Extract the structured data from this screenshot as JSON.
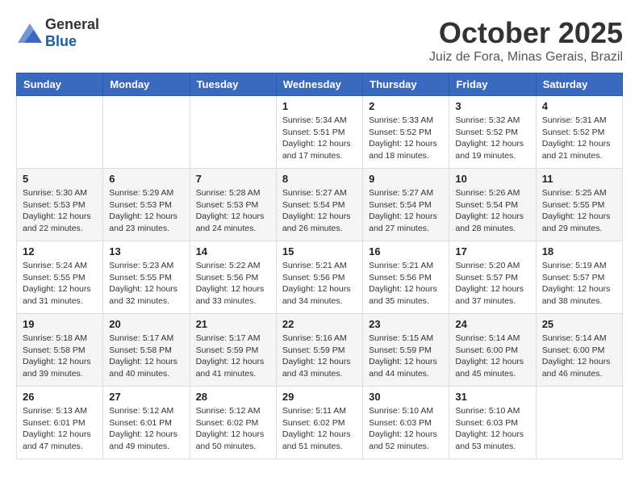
{
  "header": {
    "logo_general": "General",
    "logo_blue": "Blue",
    "month_title": "October 2025",
    "location": "Juiz de Fora, Minas Gerais, Brazil"
  },
  "days_of_week": [
    "Sunday",
    "Monday",
    "Tuesday",
    "Wednesday",
    "Thursday",
    "Friday",
    "Saturday"
  ],
  "weeks": [
    [
      {
        "day": "",
        "sunrise": "",
        "sunset": "",
        "daylight": ""
      },
      {
        "day": "",
        "sunrise": "",
        "sunset": "",
        "daylight": ""
      },
      {
        "day": "",
        "sunrise": "",
        "sunset": "",
        "daylight": ""
      },
      {
        "day": "1",
        "sunrise": "Sunrise: 5:34 AM",
        "sunset": "Sunset: 5:51 PM",
        "daylight": "Daylight: 12 hours and 17 minutes."
      },
      {
        "day": "2",
        "sunrise": "Sunrise: 5:33 AM",
        "sunset": "Sunset: 5:52 PM",
        "daylight": "Daylight: 12 hours and 18 minutes."
      },
      {
        "day": "3",
        "sunrise": "Sunrise: 5:32 AM",
        "sunset": "Sunset: 5:52 PM",
        "daylight": "Daylight: 12 hours and 19 minutes."
      },
      {
        "day": "4",
        "sunrise": "Sunrise: 5:31 AM",
        "sunset": "Sunset: 5:52 PM",
        "daylight": "Daylight: 12 hours and 21 minutes."
      }
    ],
    [
      {
        "day": "5",
        "sunrise": "Sunrise: 5:30 AM",
        "sunset": "Sunset: 5:53 PM",
        "daylight": "Daylight: 12 hours and 22 minutes."
      },
      {
        "day": "6",
        "sunrise": "Sunrise: 5:29 AM",
        "sunset": "Sunset: 5:53 PM",
        "daylight": "Daylight: 12 hours and 23 minutes."
      },
      {
        "day": "7",
        "sunrise": "Sunrise: 5:28 AM",
        "sunset": "Sunset: 5:53 PM",
        "daylight": "Daylight: 12 hours and 24 minutes."
      },
      {
        "day": "8",
        "sunrise": "Sunrise: 5:27 AM",
        "sunset": "Sunset: 5:54 PM",
        "daylight": "Daylight: 12 hours and 26 minutes."
      },
      {
        "day": "9",
        "sunrise": "Sunrise: 5:27 AM",
        "sunset": "Sunset: 5:54 PM",
        "daylight": "Daylight: 12 hours and 27 minutes."
      },
      {
        "day": "10",
        "sunrise": "Sunrise: 5:26 AM",
        "sunset": "Sunset: 5:54 PM",
        "daylight": "Daylight: 12 hours and 28 minutes."
      },
      {
        "day": "11",
        "sunrise": "Sunrise: 5:25 AM",
        "sunset": "Sunset: 5:55 PM",
        "daylight": "Daylight: 12 hours and 29 minutes."
      }
    ],
    [
      {
        "day": "12",
        "sunrise": "Sunrise: 5:24 AM",
        "sunset": "Sunset: 5:55 PM",
        "daylight": "Daylight: 12 hours and 31 minutes."
      },
      {
        "day": "13",
        "sunrise": "Sunrise: 5:23 AM",
        "sunset": "Sunset: 5:55 PM",
        "daylight": "Daylight: 12 hours and 32 minutes."
      },
      {
        "day": "14",
        "sunrise": "Sunrise: 5:22 AM",
        "sunset": "Sunset: 5:56 PM",
        "daylight": "Daylight: 12 hours and 33 minutes."
      },
      {
        "day": "15",
        "sunrise": "Sunrise: 5:21 AM",
        "sunset": "Sunset: 5:56 PM",
        "daylight": "Daylight: 12 hours and 34 minutes."
      },
      {
        "day": "16",
        "sunrise": "Sunrise: 5:21 AM",
        "sunset": "Sunset: 5:56 PM",
        "daylight": "Daylight: 12 hours and 35 minutes."
      },
      {
        "day": "17",
        "sunrise": "Sunrise: 5:20 AM",
        "sunset": "Sunset: 5:57 PM",
        "daylight": "Daylight: 12 hours and 37 minutes."
      },
      {
        "day": "18",
        "sunrise": "Sunrise: 5:19 AM",
        "sunset": "Sunset: 5:57 PM",
        "daylight": "Daylight: 12 hours and 38 minutes."
      }
    ],
    [
      {
        "day": "19",
        "sunrise": "Sunrise: 5:18 AM",
        "sunset": "Sunset: 5:58 PM",
        "daylight": "Daylight: 12 hours and 39 minutes."
      },
      {
        "day": "20",
        "sunrise": "Sunrise: 5:17 AM",
        "sunset": "Sunset: 5:58 PM",
        "daylight": "Daylight: 12 hours and 40 minutes."
      },
      {
        "day": "21",
        "sunrise": "Sunrise: 5:17 AM",
        "sunset": "Sunset: 5:59 PM",
        "daylight": "Daylight: 12 hours and 41 minutes."
      },
      {
        "day": "22",
        "sunrise": "Sunrise: 5:16 AM",
        "sunset": "Sunset: 5:59 PM",
        "daylight": "Daylight: 12 hours and 43 minutes."
      },
      {
        "day": "23",
        "sunrise": "Sunrise: 5:15 AM",
        "sunset": "Sunset: 5:59 PM",
        "daylight": "Daylight: 12 hours and 44 minutes."
      },
      {
        "day": "24",
        "sunrise": "Sunrise: 5:14 AM",
        "sunset": "Sunset: 6:00 PM",
        "daylight": "Daylight: 12 hours and 45 minutes."
      },
      {
        "day": "25",
        "sunrise": "Sunrise: 5:14 AM",
        "sunset": "Sunset: 6:00 PM",
        "daylight": "Daylight: 12 hours and 46 minutes."
      }
    ],
    [
      {
        "day": "26",
        "sunrise": "Sunrise: 5:13 AM",
        "sunset": "Sunset: 6:01 PM",
        "daylight": "Daylight: 12 hours and 47 minutes."
      },
      {
        "day": "27",
        "sunrise": "Sunrise: 5:12 AM",
        "sunset": "Sunset: 6:01 PM",
        "daylight": "Daylight: 12 hours and 49 minutes."
      },
      {
        "day": "28",
        "sunrise": "Sunrise: 5:12 AM",
        "sunset": "Sunset: 6:02 PM",
        "daylight": "Daylight: 12 hours and 50 minutes."
      },
      {
        "day": "29",
        "sunrise": "Sunrise: 5:11 AM",
        "sunset": "Sunset: 6:02 PM",
        "daylight": "Daylight: 12 hours and 51 minutes."
      },
      {
        "day": "30",
        "sunrise": "Sunrise: 5:10 AM",
        "sunset": "Sunset: 6:03 PM",
        "daylight": "Daylight: 12 hours and 52 minutes."
      },
      {
        "day": "31",
        "sunrise": "Sunrise: 5:10 AM",
        "sunset": "Sunset: 6:03 PM",
        "daylight": "Daylight: 12 hours and 53 minutes."
      },
      {
        "day": "",
        "sunrise": "",
        "sunset": "",
        "daylight": ""
      }
    ]
  ]
}
